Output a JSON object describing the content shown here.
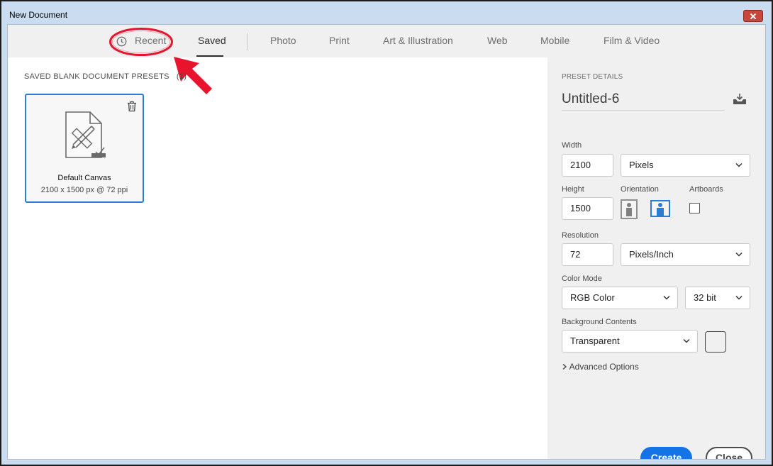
{
  "window": {
    "title": "New Document"
  },
  "tabs": [
    {
      "label": "Recent"
    },
    {
      "label": "Saved"
    },
    {
      "label": "Photo"
    },
    {
      "label": "Print"
    },
    {
      "label": "Art & Illustration"
    },
    {
      "label": "Web"
    },
    {
      "label": "Mobile"
    },
    {
      "label": "Film & Video"
    }
  ],
  "active_tab": "Saved",
  "presets": {
    "heading": "SAVED BLANK DOCUMENT PRESETS",
    "count": "(1)",
    "items": [
      {
        "name": "Default Canvas",
        "size": "2100 x 1500 px @ 72 ppi"
      }
    ]
  },
  "details": {
    "heading": "PRESET DETAILS",
    "doc_name": "Untitled-6",
    "width_label": "Width",
    "width_value": "2100",
    "width_unit": "Pixels",
    "height_label": "Height",
    "height_value": "1500",
    "orientation_label": "Orientation",
    "artboards_label": "Artboards",
    "artboards_checked": false,
    "resolution_label": "Resolution",
    "resolution_value": "72",
    "resolution_unit": "Pixels/Inch",
    "color_mode_label": "Color Mode",
    "color_mode": "RGB Color",
    "bit_depth": "32 bit",
    "background_label": "Background Contents",
    "background": "Transparent",
    "advanced_label": "Advanced Options"
  },
  "buttons": {
    "create": "Create",
    "close": "Close"
  },
  "colors": {
    "accent": "#1473e6",
    "annotation": "#e8142d"
  }
}
